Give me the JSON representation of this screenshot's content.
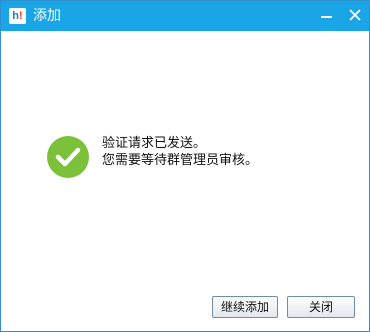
{
  "window": {
    "title": "添加",
    "app_icon_text": "h",
    "app_icon_dot": "!"
  },
  "message": {
    "line1": "验证请求已发送。",
    "line2": "您需要等待群管理员审核。"
  },
  "buttons": {
    "continue_label": "继续添加",
    "close_label": "关闭"
  },
  "colors": {
    "titlebar": "#1aa6e6",
    "success": "#7bc23a"
  },
  "icons": {
    "app": "qq-app-icon",
    "success": "check-circle-icon",
    "minimize": "minimize-icon",
    "close": "close-icon"
  }
}
